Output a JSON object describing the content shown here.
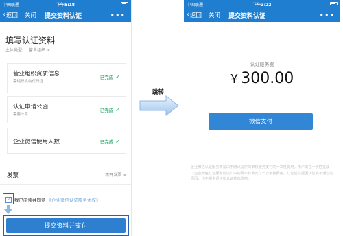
{
  "left_phone": {
    "status": {
      "carrier": "中国联通",
      "time": "下午5:18"
    },
    "nav": {
      "back": "返回",
      "close": "关闭",
      "title": "提交资料认证",
      "more": "•••"
    },
    "form_title": "填写认证资料",
    "subject": {
      "label": "主体类型:",
      "value": "营业组织 >"
    },
    "items": [
      {
        "name": "营业组织资质信息",
        "desc": "需组织机构代码证",
        "status": "已完成"
      },
      {
        "name": "认证申请公函",
        "desc": "需要公章",
        "status": "已完成"
      },
      {
        "name": "企业微信使用人数",
        "desc": "",
        "status": "已完成"
      }
    ],
    "invoice": {
      "label": "发票",
      "value": "不开发票 >"
    },
    "agree": {
      "prefix": "我已阅读并同意",
      "link": "《企业微信认证服务协议》",
      "checked": "✓"
    },
    "submit_label": "提交资料并支付"
  },
  "transition": {
    "label": "跳转"
  },
  "right_phone": {
    "status": {
      "carrier": "中国联通",
      "time": "下午3:22"
    },
    "nav": {
      "back": "返回",
      "close": "关闭",
      "title": "提交资料认证",
      "more": "•••"
    },
    "fee_label": "认证服务费",
    "currency": "¥",
    "amount": "300.00",
    "pay_label": "微信支付",
    "notice": "企业微信认证服务费是由于腾讯提供的审核服务支付的一次性费用。用户需在一次性完成《企业微信认证服务协议》中的费率标准支付一次审核费用。认证提交后因认证或不通过的原因，也不提供退还和认证状态影响。"
  },
  "colors": {
    "brand_blue": "#1f7ecf",
    "button_blue": "#2f7fd0",
    "success_green": "#1aa260",
    "highlight_border": "#2a5fb5"
  }
}
